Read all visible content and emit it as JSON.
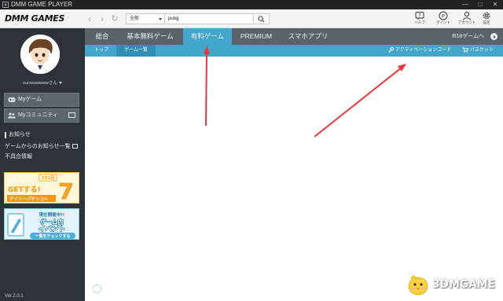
{
  "window": {
    "title": "DMM GAME PLAYER"
  },
  "toolbar": {
    "logo": "DMM GAMES",
    "search_scope": "全般",
    "search_value": "pubg",
    "items": [
      {
        "icon": "help-icon",
        "label": "ヘルプ"
      },
      {
        "icon": "point-icon",
        "label": "ポイント"
      },
      {
        "icon": "account-icon",
        "label": "アカウント"
      },
      {
        "icon": "settings-icon",
        "label": "設定"
      }
    ]
  },
  "sidebar": {
    "username": "ourseawwwwさん",
    "buttons": [
      {
        "icon": "gamepad-icon",
        "label": "Myゲーム"
      },
      {
        "icon": "community-icon",
        "label": "Myコミュニティ"
      }
    ],
    "section_title": "お知らせ",
    "links": [
      "ゲームからのお知らせ一覧",
      "不具合情報"
    ],
    "banners": [
      {
        "badge": "1日1回",
        "line1": "ポイント",
        "line2": "GETする!",
        "line3": "デイリーパチンコへ",
        "number": "7"
      },
      {
        "line0": "現在開催中!!",
        "line1": "ゲーム内",
        "line2": "イベント",
        "line3": "一覧をチェックする"
      }
    ],
    "version": "Ver.2.0.1"
  },
  "tabs": [
    {
      "label": "総合",
      "active": false
    },
    {
      "label": "基本無料ゲーム",
      "active": false
    },
    {
      "label": "有料ゲーム",
      "active": true
    },
    {
      "label": "PREMIUM",
      "active": false
    },
    {
      "label": "スマホアプリ",
      "active": false
    }
  ],
  "r18_link": "R18ゲームへ",
  "subnav": {
    "crumbs": [
      "トップ",
      "ゲーム一覧"
    ],
    "activation_code": "アクティベーションコード",
    "basket": "バスケット"
  },
  "watermark": "3DMGAME",
  "colors": {
    "accent": "#43a6cd",
    "sidebar": "#2d3338",
    "tab_bar": "#5a636a",
    "arrow": "#e8383d"
  }
}
